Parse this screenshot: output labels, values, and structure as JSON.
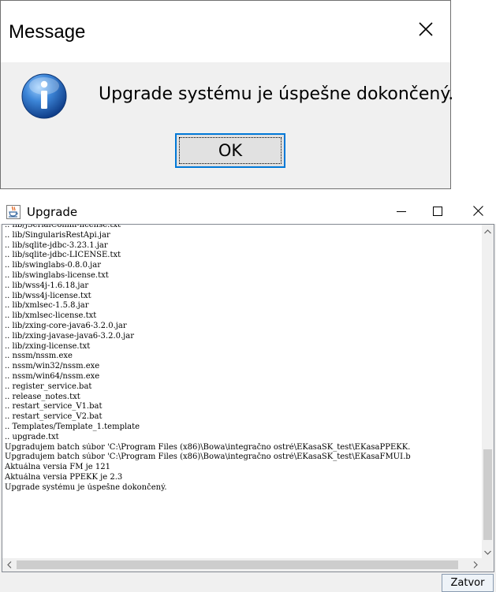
{
  "message_dialog": {
    "title": "Message",
    "icon": "info-icon",
    "text": "Upgrade systému je úspešne dokončený.",
    "ok_label": "OK"
  },
  "upgrade_window": {
    "title": "Upgrade",
    "app_icon": "java-cup-icon",
    "log_lines": [
      ".. lib/jSerialComm-license.txt",
      ".. lib/SingularisRestApi.jar",
      ".. lib/sqlite-jdbc-3.23.1.jar",
      ".. lib/sqlite-jdbc-LICENSE.txt",
      ".. lib/swinglabs-0.8.0.jar",
      ".. lib/swinglabs-license.txt",
      ".. lib/wss4j-1.6.18.jar",
      ".. lib/wss4j-license.txt",
      ".. lib/xmlsec-1.5.8.jar",
      ".. lib/xmlsec-license.txt",
      ".. lib/zxing-core-java6-3.2.0.jar",
      ".. lib/zxing-javase-java6-3.2.0.jar",
      ".. lib/zxing-license.txt",
      ".. nssm/nssm.exe",
      ".. nssm/win32/nssm.exe",
      ".. nssm/win64/nssm.exe",
      ".. register_service.bat",
      ".. release_notes.txt",
      ".. restart_service_V1.bat",
      ".. restart_service_V2.bat",
      ".. Templates/Template_1.template",
      ".. upgrade.txt",
      "Upgradujem batch súbor 'C:\\Program Files (x86)\\Bowa\\integračno ostré\\EKasaSK_test\\EKasaPPEKK.",
      "Upgradujem batch súbor 'C:\\Program Files (x86)\\Bowa\\integračno ostré\\EKasaSK_test\\EKasaFMUI.b",
      "Aktuálna versia FM je 121",
      "Aktuálna versia PPEKK je 2.3",
      "Upgrade systému je úspešne dokončený."
    ],
    "close_button_label": "Zatvor"
  },
  "colors": {
    "focus_border": "#0078d7",
    "info_icon_blue": "#1a5fb4"
  }
}
